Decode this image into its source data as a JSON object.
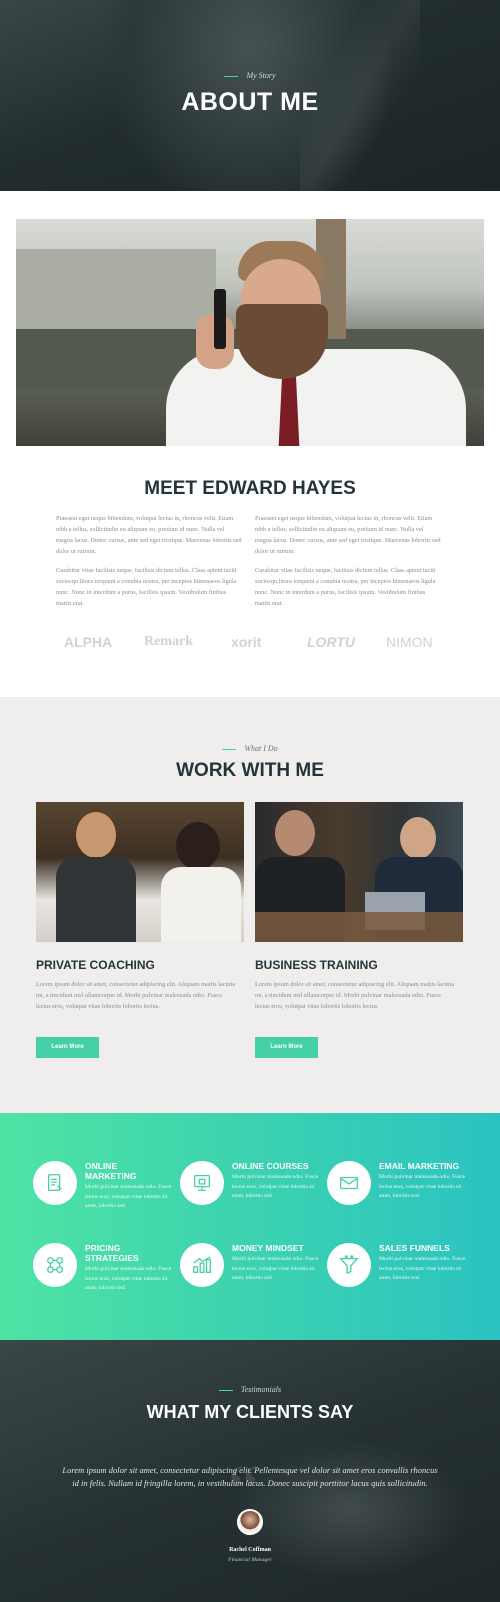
{
  "hero": {
    "eyebrow": "My Story",
    "title": "ABOUT ME"
  },
  "meet": {
    "title": "MEET EDWARD HAYES",
    "col_left": [
      "Praesent eget neque bibendum, volutpat lectus in, rhoncus velit. Etiam nibh a tellus, sollicitudin eu aliquam eu, pretium id nunc. Nulla vel magna lacus. Donec cursus, ante sed eget tristique. Maecenas lobortis sed dolor ut rutrum.",
      "Curabitur vitae facilisis neque, facilisis dictum tellus. Class aptent taciti sociosqu litora torquent a conubia nostra, per inceptos himenaeos ligula nunc. Nunc in interdum a purus, facilisis ipsum. Vestibulum finibus mattis erat."
    ],
    "col_right": [
      "Praesent eget neque bibendum, volutpat lectus in, rhoncus velit. Etiam nibh a tellus, sollicitudin eu aliquam eu, pretium id nunc. Nulla vel magna lacus. Donec cursus, ante sed eget tristique. Maecenas lobortis sed dolor ut rutrum.",
      "Curabitur vitae facilisis neque, facilisis dictum tellus. Class aptent taciti sociosqu litora torquent a conubia nostra, per inceptos himenaeos ligula nunc. Nunc in interdum a purus, facilisis ipsum. Vestibulum finibus mattis erat."
    ],
    "logos": [
      "ALPHA",
      "Remark",
      "xorit",
      "LORTU",
      "NIMON"
    ]
  },
  "work": {
    "eyebrow": "What I Do",
    "title": "WORK WITH ME",
    "cards": [
      {
        "title": "PRIVATE COACHING",
        "text": "Lorem ipsum dolor sit amet, consectetur adipiscing elit. Aliquam mattis lacinia mi, a tincidunt nisl ullamcorper id. Morbi pulvinar malesuada odio. Fusce lectus eros, volutpat vitae lobortis lobortis lectus.",
        "button": "Learn More"
      },
      {
        "title": "BUSINESS TRAINING",
        "text": "Lorem ipsum dolor sit amet, consectetur adipiscing elit. Aliquam mattis lacinia mi, a tincidunt nisl ullamcorper id. Morbi pulvinar malesuada odio. Fusce lectus eros, volutpat vitae lobortis lobortis lectus.",
        "button": "Learn More"
      }
    ]
  },
  "services": [
    {
      "title": "ONLINE MARKETING",
      "text": "Morbi pulvinar malesuada odio. Fusce lectus eros, volutpat vitae lobortis sit amet, lobortis sed.",
      "icon": "marketing-icon"
    },
    {
      "title": "ONLINE COURSES",
      "text": "Morbi pulvinar malesuada odio. Fusce lectus eros, volutpat vitae lobortis sit amet, lobortis sed.",
      "icon": "courses-icon"
    },
    {
      "title": "EMAIL MARKETING",
      "text": "Morbi pulvinar malesuada odio. Fusce lectus eros, volutpat vitae lobortis sit amet, lobortis sed.",
      "icon": "email-icon"
    },
    {
      "title": "PRICING STRATEGIES",
      "text": "Morbi pulvinar malesuada odio. Fusce lectus eros, volutpat vitae lobortis sit amet, lobortis sed.",
      "icon": "pricing-icon"
    },
    {
      "title": "MONEY MINDSET",
      "text": "Morbi pulvinar malesuada odio. Fusce lectus eros, volutpat vitae lobortis sit amet, lobortis sed.",
      "icon": "money-icon"
    },
    {
      "title": "SALES FUNNELS",
      "text": "Morbi pulvinar malesuada odio. Fusce lectus eros, volutpat vitae lobortis sit amet, lobortis sed.",
      "icon": "funnel-icon"
    }
  ],
  "testimonials": {
    "eyebrow": "Testimonials",
    "title": "WHAT MY CLIENTS SAY",
    "quote": "Lorem ipsum dolor sit amet, consectetur adipiscing elit. Pellentesque vel dolor sit amet eros convallis rhoncus id in felis. Nullam id fringilla lorem, in vestibulum lacus. Donec suscipit porttitor lacus quis sollicitudin.",
    "author": "Rachel Coffman",
    "role": "Financial Manager"
  },
  "colors": {
    "accent": "#45cfa6",
    "dark": "#24353a",
    "gradient_start": "#4fe3a4",
    "gradient_end": "#2bc3c2"
  }
}
